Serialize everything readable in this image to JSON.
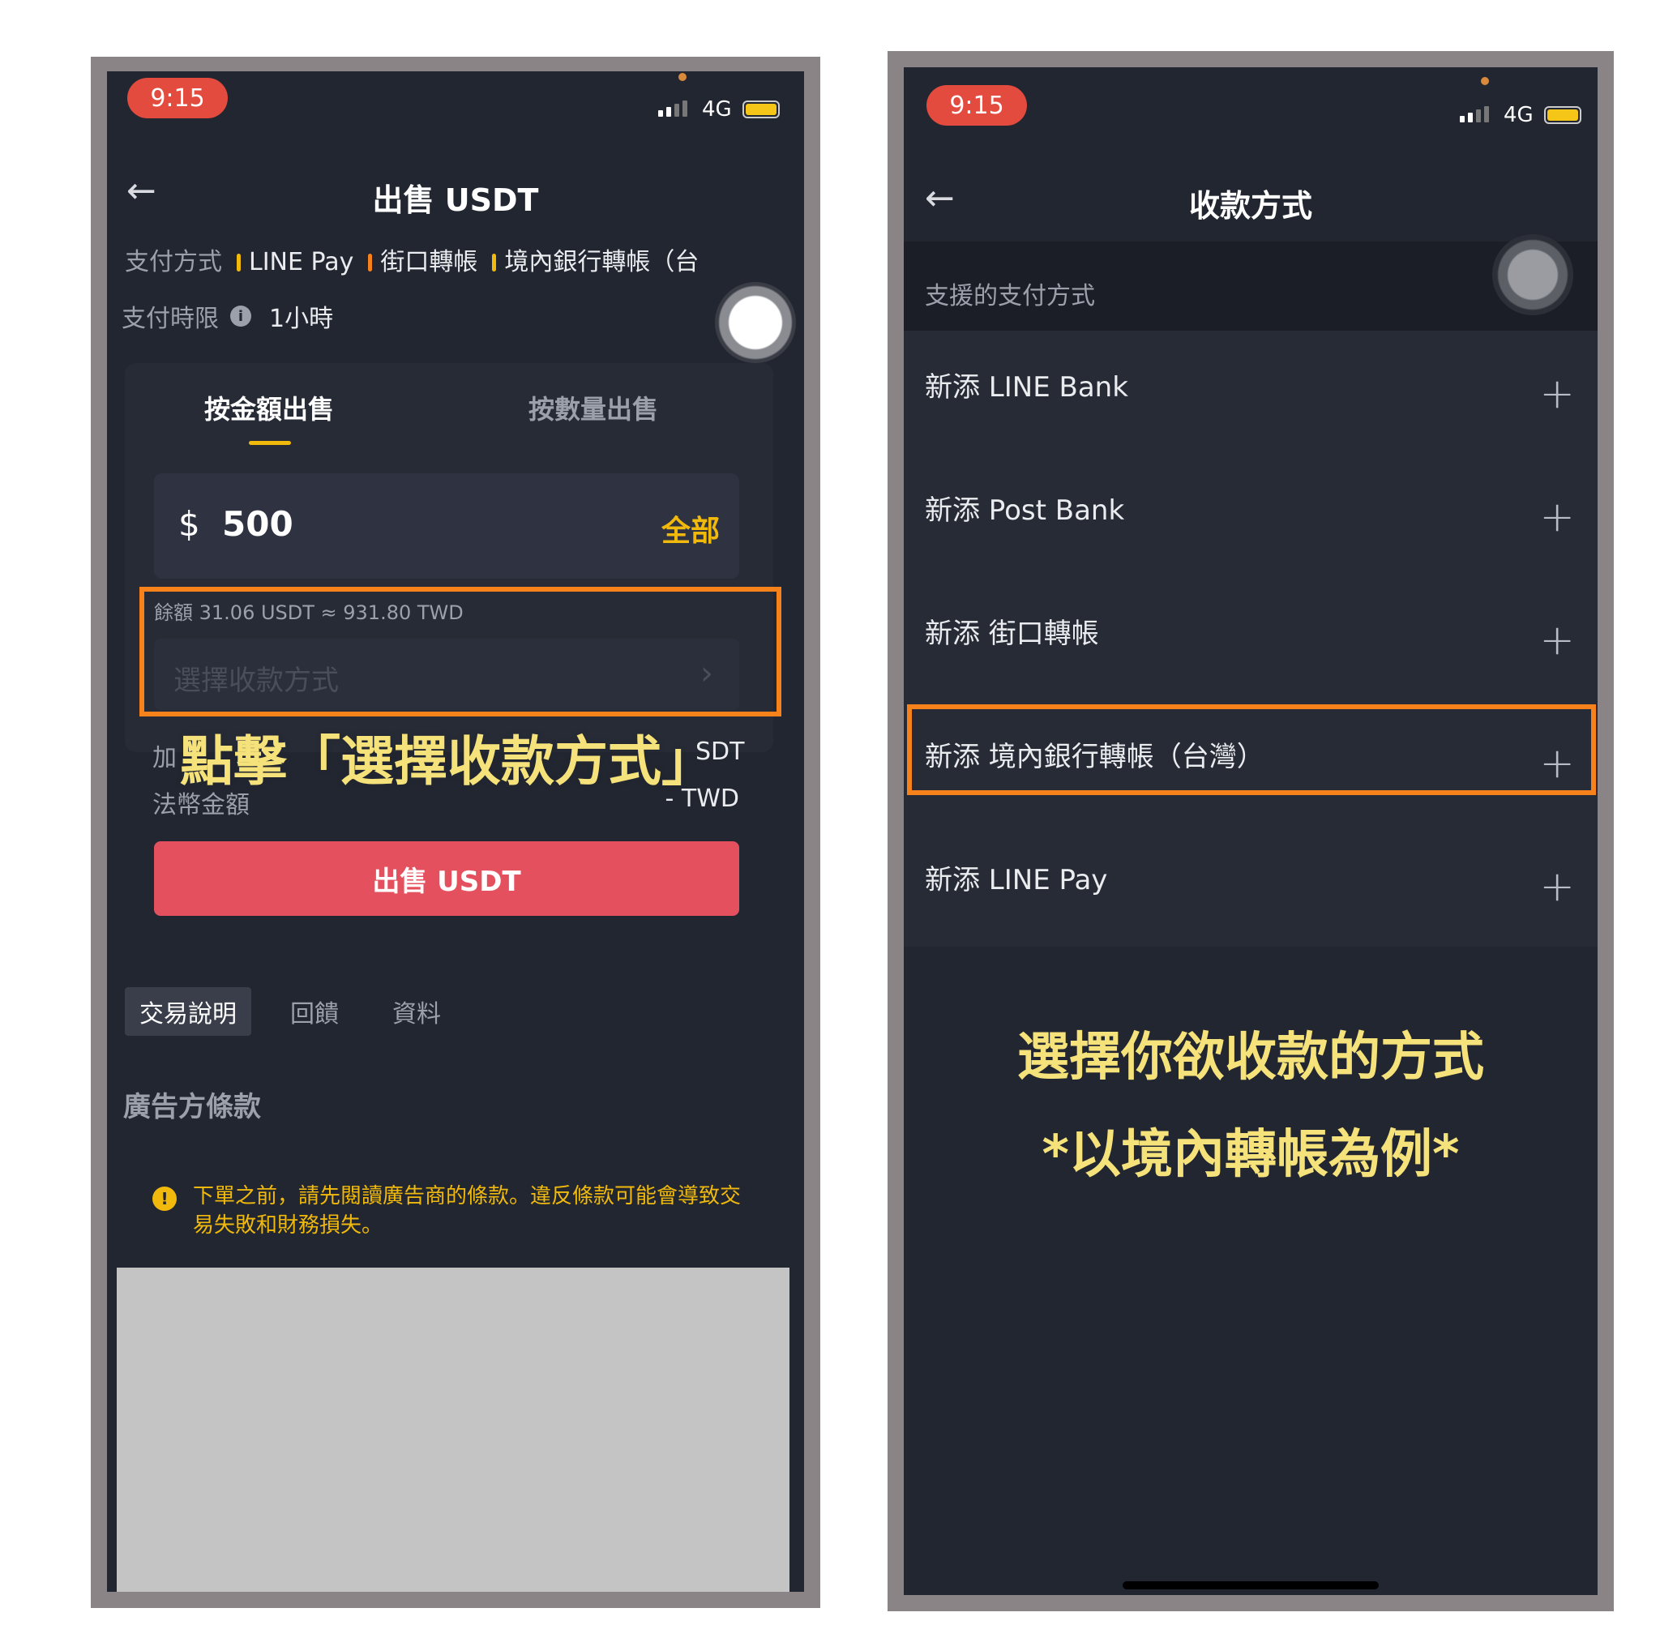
{
  "left": {
    "status": {
      "time": "9:15",
      "network": "4G"
    },
    "title": "出售 USDT",
    "payment_label": "支付方式",
    "payment_methods": [
      "LINE Pay",
      "街口轉帳",
      "境內銀行轉帳（台"
    ],
    "payment_colors": [
      "#f0b90b",
      "#f7821b",
      "#f0b90b"
    ],
    "time_limit_label": "支付時限",
    "time_limit_value": "1小時",
    "tabs": {
      "by_amount": "按金額出售",
      "by_quantity": "按數量出售"
    },
    "amount": {
      "currency": "$",
      "value": "500",
      "all": "全部"
    },
    "balance": "餘額 31.06 USDT ≈ 931.80 TWD",
    "select_method_placeholder": "選擇收款方式",
    "crypto_row": {
      "label": "加",
      "suffix": "SDT"
    },
    "fiat_row": {
      "label": "法幣金額",
      "value": "- TWD"
    },
    "sell_button": "出售 USDT",
    "bottom_tabs": [
      "交易說明",
      "回饋",
      "資料"
    ],
    "terms_heading": "廣告方條款",
    "warning": "下單之前，請先閱讀廣告商的條款。違反條款可能會導致交易失敗和財務損失。",
    "annotation": "點擊「選擇收款方式」"
  },
  "right": {
    "status": {
      "time": "9:15",
      "network": "4G"
    },
    "title": "收款方式",
    "section_label": "支援的支付方式",
    "methods": [
      "新添 LINE Bank",
      "新添 Post Bank",
      "新添 街口轉帳",
      "新添 境內銀行轉帳（台灣）",
      "新添 LINE Pay"
    ],
    "annotation_line1": "選擇你欲收款的方式",
    "annotation_line2": "*以境內轉帳為例*"
  },
  "colors": {
    "accent_yellow": "#f0b90b",
    "sell_red": "#e5505f",
    "highlight_orange": "#f7821b",
    "annotation_yellow": "#f6e27a"
  }
}
